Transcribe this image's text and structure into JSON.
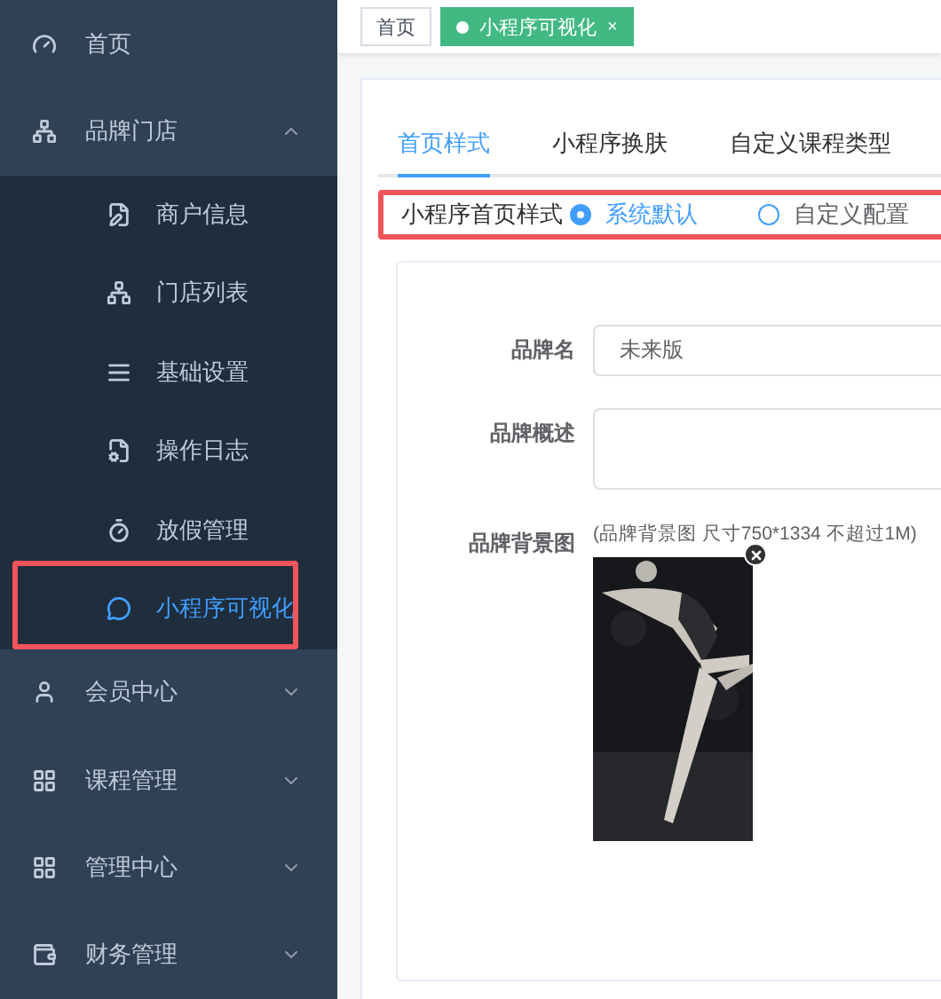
{
  "sidebar": {
    "items": [
      {
        "label": "首页",
        "selected": false
      },
      {
        "label": "品牌门店",
        "expanded": true,
        "children": [
          {
            "label": "商户信息",
            "selected": false
          },
          {
            "label": "门店列表",
            "selected": false
          },
          {
            "label": "基础设置",
            "selected": false
          },
          {
            "label": "操作日志",
            "selected": false
          },
          {
            "label": "放假管理",
            "selected": false
          },
          {
            "label": "小程序可视化",
            "selected": true,
            "highlighted": true
          }
        ]
      },
      {
        "label": "会员中心",
        "expanded": false
      },
      {
        "label": "课程管理",
        "expanded": false
      },
      {
        "label": "管理中心",
        "expanded": false
      },
      {
        "label": "财务管理",
        "expanded": false
      }
    ]
  },
  "tags": [
    {
      "label": "首页",
      "selected": false
    },
    {
      "label": "小程序可视化",
      "selected": true,
      "close": "×"
    }
  ],
  "tabs": [
    {
      "label": "首页样式",
      "selected": true
    },
    {
      "label": "小程序换肤",
      "selected": false
    },
    {
      "label": "自定义课程类型",
      "selected": false
    }
  ],
  "style_option": {
    "label": "小程序首页样式",
    "highlighted": true,
    "options": [
      {
        "label": "系统默认",
        "selected": true
      },
      {
        "label": "自定义配置",
        "selected": false
      }
    ]
  },
  "form": {
    "brand_name": {
      "label": "品牌名",
      "value": "未来版"
    },
    "brand_description": {
      "label": "品牌概述"
    },
    "brand_background": {
      "label": "品牌背景图",
      "hint": "(品牌背景图 尺寸750*1334 不超过1M)"
    }
  }
}
